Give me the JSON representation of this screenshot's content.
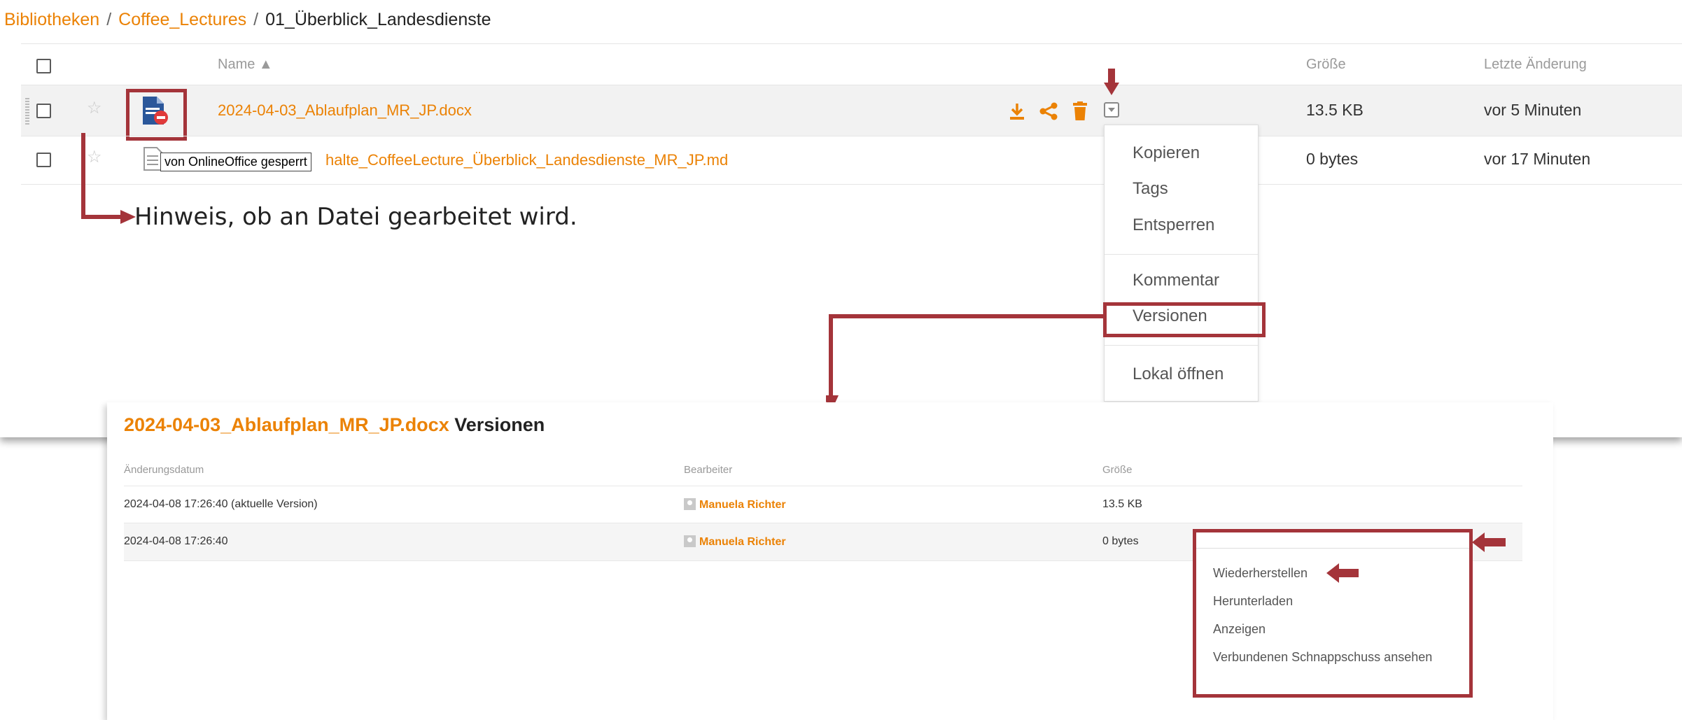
{
  "breadcrumb": {
    "root": "Bibliotheken",
    "library": "Coffee_Lectures",
    "folder": "01_Überblick_Landesdienste"
  },
  "table": {
    "col_name": "Name ▲",
    "col_size": "Größe",
    "col_modified": "Letzte Änderung"
  },
  "files": [
    {
      "name": "2024-04-03_Ablaufplan_MR_JP.docx",
      "size": "13.5 KB",
      "modified": "vor 5 Minuten",
      "locked": true
    },
    {
      "name": "Inhalte_CoffeeLecture_Überblick_Landesdienste_MR_JP.md",
      "name_visible": "halte_CoffeeLecture_Überblick_Landesdienste_MR_JP.md",
      "size": "0 bytes",
      "modified": "vor 17 Minuten",
      "locked": false
    }
  ],
  "lock_tooltip": "von OnlineOffice gesperrt",
  "hint_text": "Hinweis, ob an Datei gearbeitet wird.",
  "context_menu": [
    "Kopieren",
    "Tags",
    "Entsperren",
    "Kommentar",
    "Versionen",
    "Lokal öffnen"
  ],
  "versions": {
    "title_file": "2024-04-03_Ablaufplan_MR_JP.docx",
    "title_label": "Versionen",
    "col_date": "Änderungsdatum",
    "col_editor": "Bearbeiter",
    "col_size": "Größe",
    "rows": [
      {
        "date": "2024-04-08 17:26:40 (aktuelle Version)",
        "editor": "Manuela Richter",
        "size": "13.5 KB"
      },
      {
        "date": "2024-04-08 17:26:40",
        "editor": "Manuela Richter",
        "size": "0 bytes"
      }
    ],
    "menu": [
      "Wiederherstellen",
      "Herunterladen",
      "Anzeigen",
      "Verbundenen Schnappschuss ansehen"
    ]
  },
  "colors": {
    "accent": "#eb8205",
    "annotation": "#a4343a"
  }
}
